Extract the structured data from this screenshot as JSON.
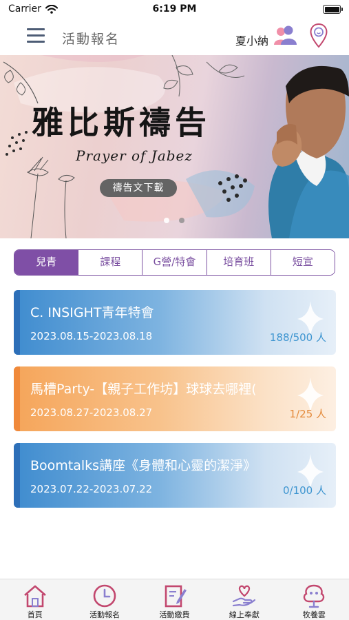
{
  "status_bar": {
    "carrier": "Carrier",
    "time": "6:19 PM"
  },
  "nav": {
    "title": "活動報名",
    "user_name": "夏小納"
  },
  "banner": {
    "title": "雅比斯禱告",
    "subtitle": "Prayer of Jabez",
    "download_label": "禱告文下載",
    "page_count": 2,
    "current_page": 1
  },
  "tabs": [
    {
      "label": "兒青",
      "active": true
    },
    {
      "label": "課程",
      "active": false
    },
    {
      "label": "G營/特會",
      "active": false
    },
    {
      "label": "培育班",
      "active": false
    },
    {
      "label": "短宣",
      "active": false
    }
  ],
  "activities": [
    {
      "title": "C. INSIGHT青年特會",
      "date_range": "2023.08.15-2023.08.18",
      "count": "188/500 人",
      "color": "#3f8ccf"
    },
    {
      "title": "馬槽Party-【親子工作坊】球球去哪裡(",
      "date_range": "2023.08.27-2023.08.27",
      "count": "1/25 人",
      "color": "#f5a55a"
    },
    {
      "title": "Boomtalks講座《身體和心靈的潔淨》",
      "date_range": "2023.07.22-2023.07.22",
      "count": "0/100 人",
      "color": "#3f8ccf"
    }
  ],
  "bottom_tabs": [
    {
      "label": "首頁",
      "icon": "home-icon"
    },
    {
      "label": "活動報名",
      "icon": "clock-icon",
      "active": true
    },
    {
      "label": "活動繳費",
      "icon": "edit-document-icon"
    },
    {
      "label": "線上奉獻",
      "icon": "heart-hand-icon"
    },
    {
      "label": "牧養雲",
      "icon": "tree-icon"
    }
  ],
  "colors": {
    "accent_purple": "#7f4fa6",
    "icon_pink": "#c2476e",
    "card_blue": "#3f8ccf",
    "card_orange": "#f5a55a"
  }
}
